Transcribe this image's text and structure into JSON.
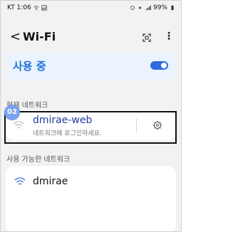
{
  "status_bar": {
    "time": "KT 1:06",
    "battery": "99%"
  },
  "header": {
    "title": "Wi-Fi"
  },
  "wifi_toggle": {
    "label": "사용 중",
    "state": "on"
  },
  "current_network": {
    "section_label": "현재 네트워크",
    "name": "dmirae-web",
    "subtitle": "네트워크에 로그인하세요.",
    "step_badge": "02"
  },
  "available_networks": {
    "section_label": "사용 가능한 네트워크",
    "items": [
      {
        "name": "dmirae"
      }
    ]
  },
  "colors": {
    "accent": "#2f6be0",
    "highlight_border": "#111111",
    "badge": "#7aa2ef"
  }
}
